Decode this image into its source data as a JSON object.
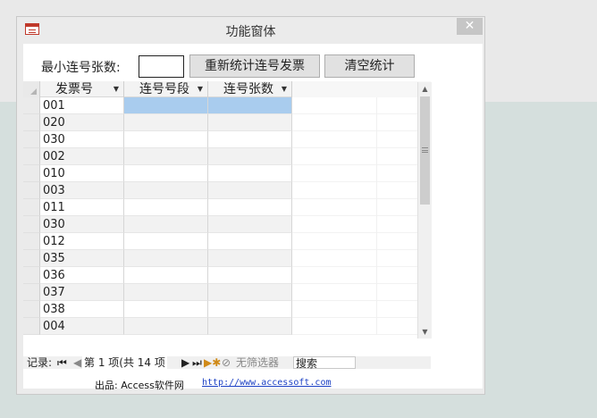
{
  "window": {
    "title": "功能窗体",
    "close_label": "✕"
  },
  "controls": {
    "min_label": "最小连号张数:",
    "min_value": "",
    "recalc_label": "重新统计连号发票",
    "clear_label": "清空统计"
  },
  "grid": {
    "headers": [
      "发票号",
      "连号号段",
      "连号张数"
    ],
    "rows": [
      {
        "invoice": "001"
      },
      {
        "invoice": "020"
      },
      {
        "invoice": "030"
      },
      {
        "invoice": "002"
      },
      {
        "invoice": "010"
      },
      {
        "invoice": "003"
      },
      {
        "invoice": "011"
      },
      {
        "invoice": "030"
      },
      {
        "invoice": "012"
      },
      {
        "invoice": "035"
      },
      {
        "invoice": "036"
      },
      {
        "invoice": "037"
      },
      {
        "invoice": "038"
      },
      {
        "invoice": "004"
      }
    ]
  },
  "navbar": {
    "record_label": "记录:",
    "first": "⏮",
    "prev": "◀",
    "position": "第 1 项(共 14 项",
    "next": "▶",
    "last": "⏭",
    "new": "▶✱",
    "filter_icon": "⊘",
    "filter_label": "无筛选器",
    "search_label": "搜索"
  },
  "footer": {
    "produced_by": "出品: Access软件网",
    "url": "http://www.accessoft.com"
  }
}
